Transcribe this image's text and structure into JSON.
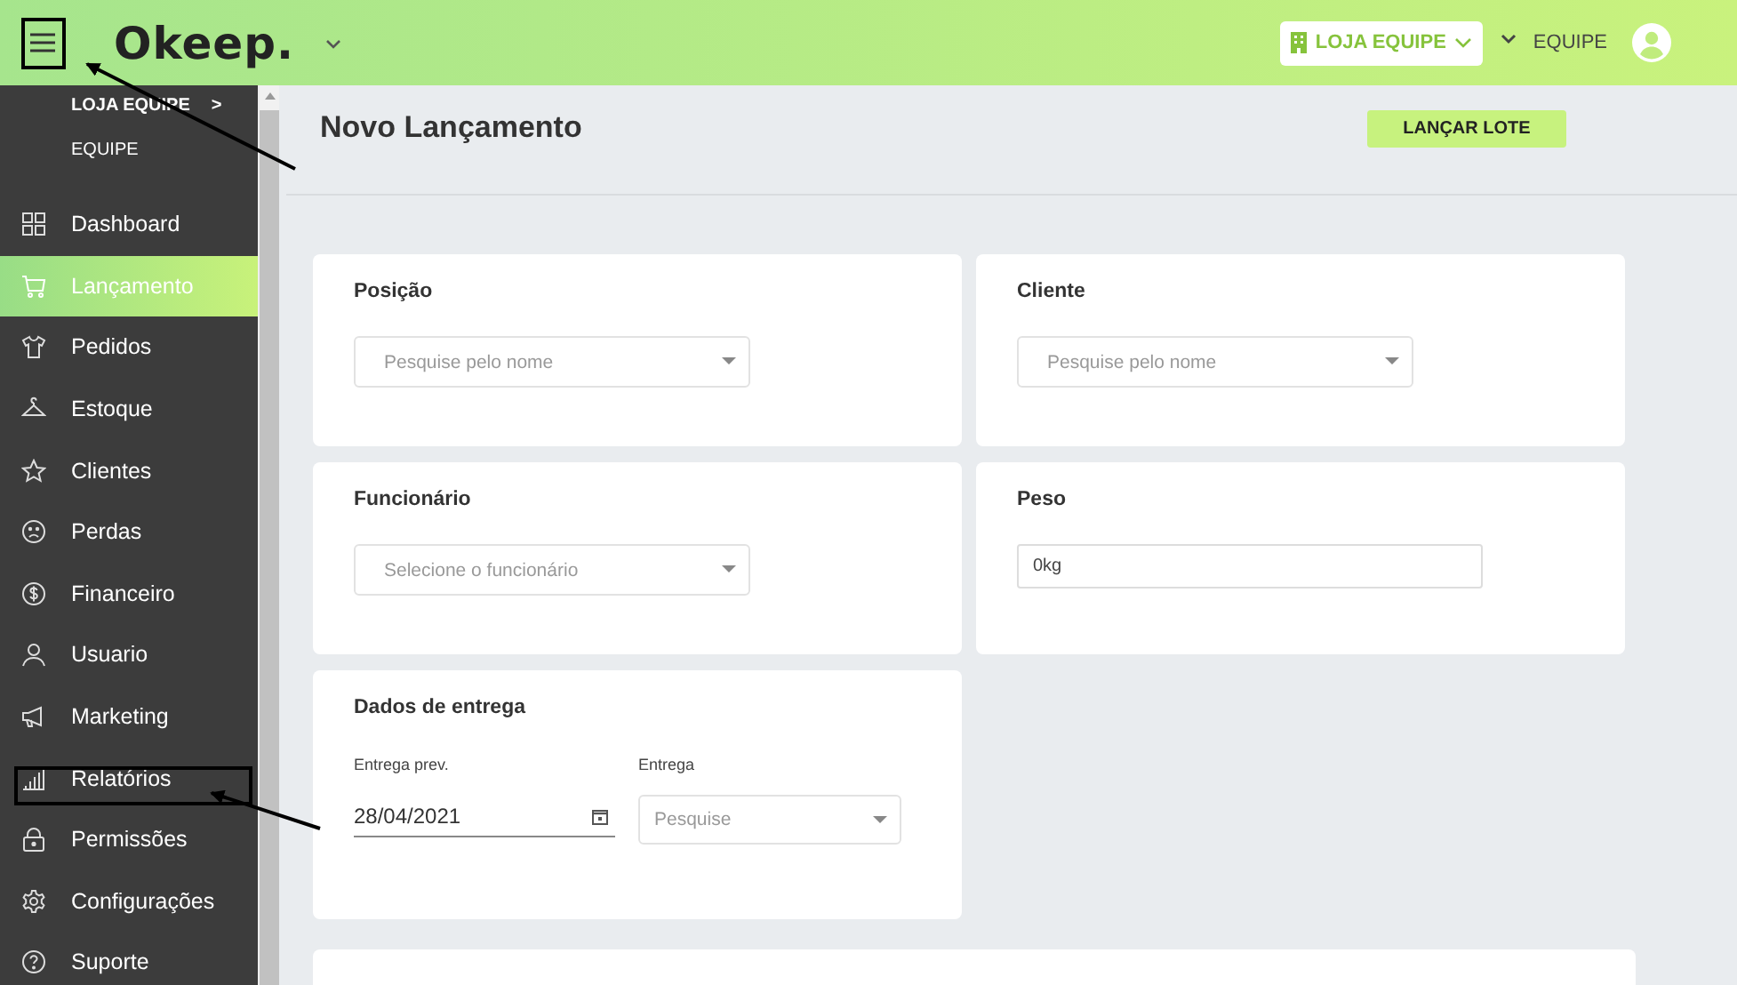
{
  "topbar": {
    "logo": "Okeep.",
    "store_selector": "LOJA EQUIPE",
    "user": "EQUIPE"
  },
  "sidebar": {
    "store": "LOJA EQUIPE",
    "store_arrow": ">",
    "team": "EQUIPE",
    "items": [
      {
        "label": "Dashboard",
        "selected": false
      },
      {
        "label": "Lançamento",
        "selected": true
      },
      {
        "label": "Pedidos",
        "selected": false
      },
      {
        "label": "Estoque",
        "selected": false
      },
      {
        "label": "Clientes",
        "selected": false
      },
      {
        "label": "Perdas",
        "selected": false
      },
      {
        "label": "Financeiro",
        "selected": false
      },
      {
        "label": "Usuario",
        "selected": false
      },
      {
        "label": "Marketing",
        "selected": false
      },
      {
        "label": "Relatórios",
        "selected": false
      },
      {
        "label": "Permissões",
        "selected": false
      },
      {
        "label": "Configurações",
        "selected": false
      },
      {
        "label": "Suporte",
        "selected": false
      }
    ]
  },
  "page": {
    "title": "Novo Lançamento",
    "action_button": "LANÇAR LOTE"
  },
  "cards": [
    {
      "title": "Posição",
      "fields": [
        {
          "kind": "select",
          "placeholder": "Pesquise pelo nome"
        }
      ]
    },
    {
      "title": "Cliente",
      "fields": [
        {
          "kind": "select",
          "placeholder": "Pesquise pelo nome"
        }
      ]
    },
    {
      "title": "Funcionário",
      "fields": [
        {
          "kind": "select",
          "placeholder": "Selecione o funcionário"
        }
      ]
    },
    {
      "title": "Peso",
      "fields": [
        {
          "kind": "text",
          "value": "0kg"
        }
      ]
    },
    {
      "title": "Dados de entrega",
      "fields": [
        {
          "kind": "date",
          "label": "Entrega prev.",
          "value": "28/04/2021"
        },
        {
          "kind": "select",
          "label": "Entrega",
          "placeholder": "Pesquise"
        }
      ]
    }
  ]
}
